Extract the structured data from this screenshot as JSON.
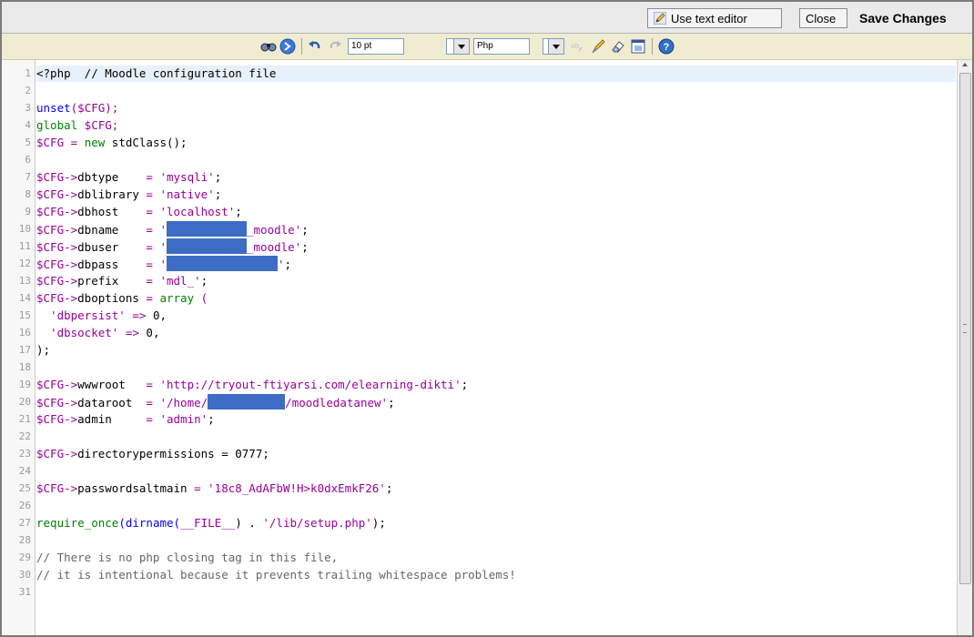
{
  "topbar": {
    "use_text_editor": "Use text editor",
    "close": "Close",
    "save_changes": "Save Changes"
  },
  "toolbar": {
    "font_size": "10 pt",
    "language": "Php",
    "icons": [
      "search-icon",
      "go-icon",
      "undo-icon",
      "redo-icon",
      "spellcheck-icon",
      "highlight-icon",
      "eraser-icon",
      "fullscreen-icon",
      "help-icon"
    ]
  },
  "editor": {
    "lines": [
      {
        "n": "1"
      },
      {
        "n": "2"
      },
      {
        "n": "3"
      },
      {
        "n": "4"
      },
      {
        "n": "5"
      },
      {
        "n": "6"
      },
      {
        "n": "7"
      },
      {
        "n": "8"
      },
      {
        "n": "9"
      },
      {
        "n": "10"
      },
      {
        "n": "11"
      },
      {
        "n": "12"
      },
      {
        "n": "13"
      },
      {
        "n": "14"
      },
      {
        "n": "15"
      },
      {
        "n": "16"
      },
      {
        "n": "17"
      },
      {
        "n": "18"
      },
      {
        "n": "19"
      },
      {
        "n": "20"
      },
      {
        "n": "21"
      },
      {
        "n": "22"
      },
      {
        "n": "23"
      },
      {
        "n": "24"
      },
      {
        "n": "25"
      },
      {
        "n": "26"
      },
      {
        "n": "27"
      },
      {
        "n": "28"
      },
      {
        "n": "29"
      },
      {
        "n": "30"
      },
      {
        "n": "31"
      }
    ],
    "code": {
      "l1": "<?php  // Moodle configuration file",
      "l3a": "unset",
      "l3b": "($CFG);",
      "l4a": "global",
      "l4b": " $CFG;",
      "l5a": "$CFG = ",
      "l5b": "new",
      "l5c": " stdClass();",
      "l7a": "$CFG->",
      "l7b": "dbtype",
      "l7c": "    = ",
      "l7d": "'mysqli'",
      "l7e": ";",
      "l8a": "$CFG->",
      "l8b": "dblibrary",
      "l8c": " = ",
      "l8d": "'native'",
      "l8e": ";",
      "l9a": "$CFG->",
      "l9b": "dbhost",
      "l9c": "    = ",
      "l9d": "'localhost'",
      "l9e": ";",
      "l10a": "$CFG->",
      "l10b": "dbname",
      "l10c": "    = ",
      "l10d": "'",
      "l10e": "_moodle'",
      "l10f": ";",
      "l11a": "$CFG->",
      "l11b": "dbuser",
      "l11c": "    = ",
      "l11d": "'",
      "l11e": "_moodle'",
      "l11f": ";",
      "l12a": "$CFG->",
      "l12b": "dbpass",
      "l12c": "    = ",
      "l12d": "'",
      "l12e": "'",
      "l12f": ";",
      "l13a": "$CFG->",
      "l13b": "prefix",
      "l13c": "    = ",
      "l13d": "'mdl_'",
      "l13e": ";",
      "l14a": "$CFG->",
      "l14b": "dboptions",
      "l14c": " = ",
      "l14d": "array",
      "l14e": " (",
      "l15a": "  'dbpersist'",
      "l15b": " => ",
      "l15c": "0,",
      "l16a": "  'dbsocket'",
      "l16b": " => ",
      "l16c": "0,",
      "l17": ");",
      "l19a": "$CFG->",
      "l19b": "wwwroot",
      "l19c": "   = ",
      "l19d": "'http://tryout-ftiyarsi.com/elearning-dikti'",
      "l19e": ";",
      "l20a": "$CFG->",
      "l20b": "dataroot",
      "l20c": "  = ",
      "l20d": "'/home/",
      "l20e": "/moodledatanew'",
      "l20f": ";",
      "l21a": "$CFG->",
      "l21b": "admin",
      "l21c": "     = ",
      "l21d": "'admin'",
      "l21e": ";",
      "l23a": "$CFG->",
      "l23b": "directorypermissions",
      "l23c": " = 0777;",
      "l25a": "$CFG->",
      "l25b": "passwordsaltmain",
      "l25c": " = ",
      "l25d": "'18c8_AdAFbW!H>k0dxEmkF26'",
      "l25e": ";",
      "l27a": "require_once",
      "l27b": "(dirname(",
      "l27c": "__FILE__",
      "l27d": ") . ",
      "l27e": "'/lib/setup.php'",
      "l27f": ");",
      "l29": "// There is no php closing tag in this file,",
      "l30": "// it is intentional because it prevents trailing whitespace problems!"
    }
  }
}
